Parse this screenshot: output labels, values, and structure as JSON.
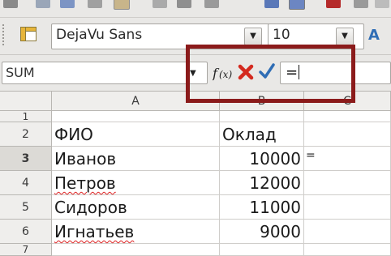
{
  "toolbar": {
    "font_name": "DejaVu Sans",
    "font_size": "10"
  },
  "formula_bar": {
    "name_box": "SUM",
    "function_wizard_icon": "f(x)-icon",
    "cancel_icon": "x-icon",
    "accept_icon": "check-icon",
    "content": "="
  },
  "sheet": {
    "columns": [
      "A",
      "B",
      "C"
    ],
    "rows": [
      {
        "num": "1",
        "a": "",
        "b": ""
      },
      {
        "num": "2",
        "a": "ФИО",
        "b": "Оклад"
      },
      {
        "num": "3",
        "a": "Иванов",
        "b": "10000",
        "c": "="
      },
      {
        "num": "4",
        "a": "Петров",
        "b": "12000"
      },
      {
        "num": "5",
        "a": "Сидоров",
        "b": "11000"
      },
      {
        "num": "6",
        "a": "Игнатьев",
        "b": "9000"
      },
      {
        "num": "7",
        "a": "",
        "b": ""
      }
    ],
    "active_row": "3"
  },
  "colors": {
    "highlight_border": "#8b1b1b",
    "cancel": "#d42a1f",
    "accept": "#2f6db5"
  }
}
